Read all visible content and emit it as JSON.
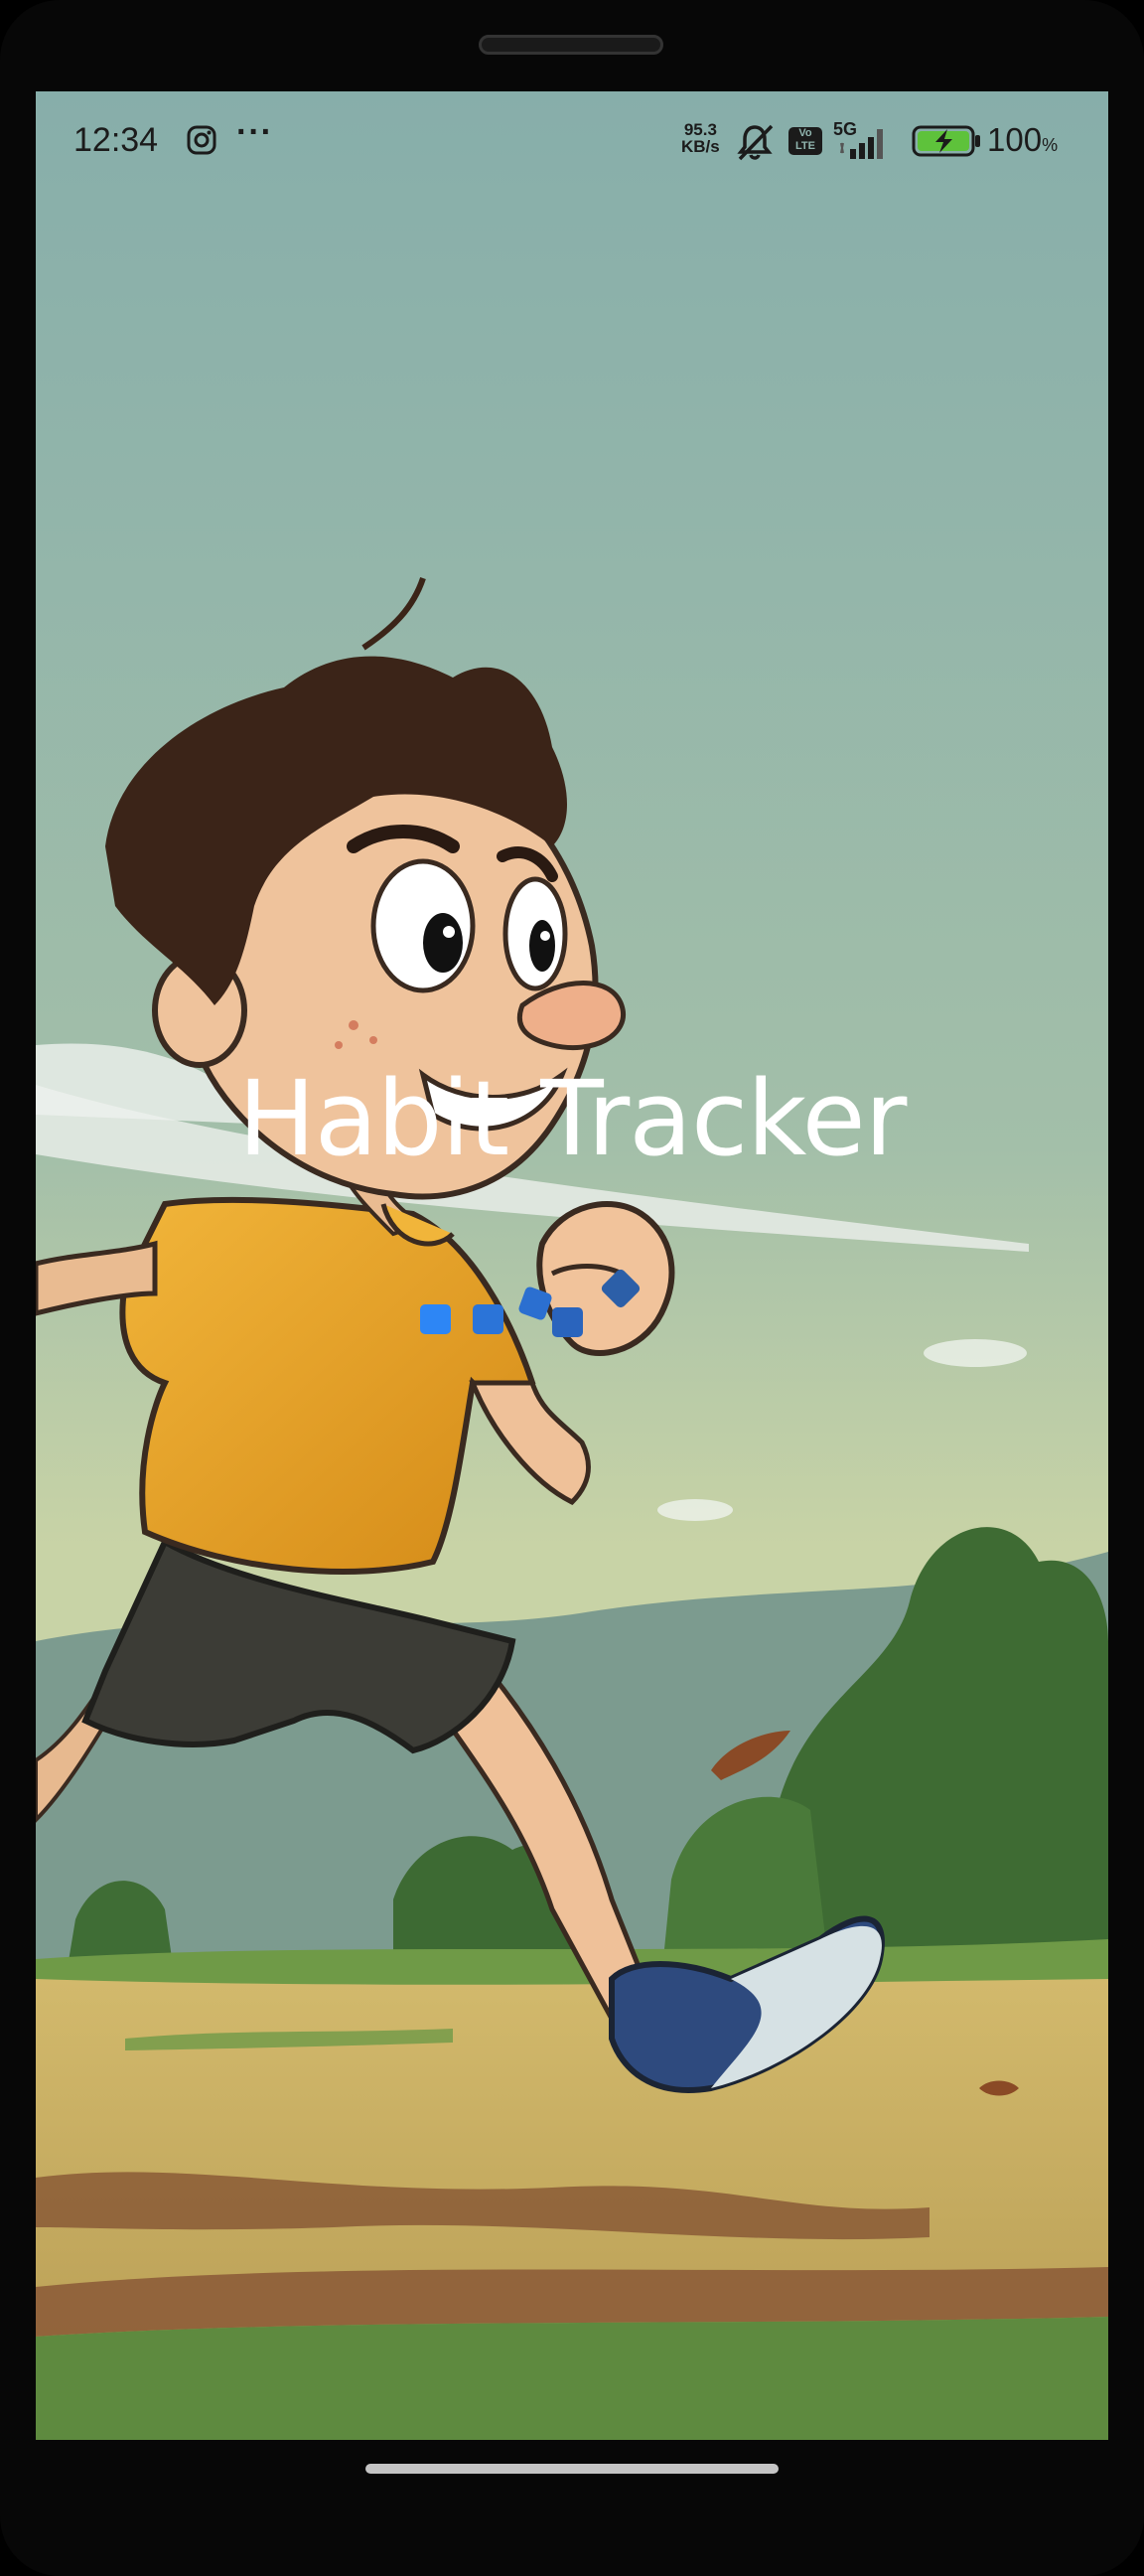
{
  "status_bar": {
    "time": "12:34",
    "net_speed_value": "95.3",
    "net_speed_unit": "KB/s",
    "volte_top": "Vo",
    "volte_bottom": "LTE",
    "network": "5G",
    "battery_percent": "100",
    "battery_percent_sign": "%",
    "battery_level": 1.0,
    "icons": [
      "instagram-icon",
      "more-icon",
      "mute-icon",
      "volte-icon",
      "signal-icon",
      "battery-charging-icon"
    ]
  },
  "splash": {
    "title": "Habit Tracker",
    "loader_color": "#2b74d8"
  },
  "colors": {
    "sky": "#8fb3ad",
    "accent": "#2b74d8",
    "battery": "#5ec23b"
  }
}
